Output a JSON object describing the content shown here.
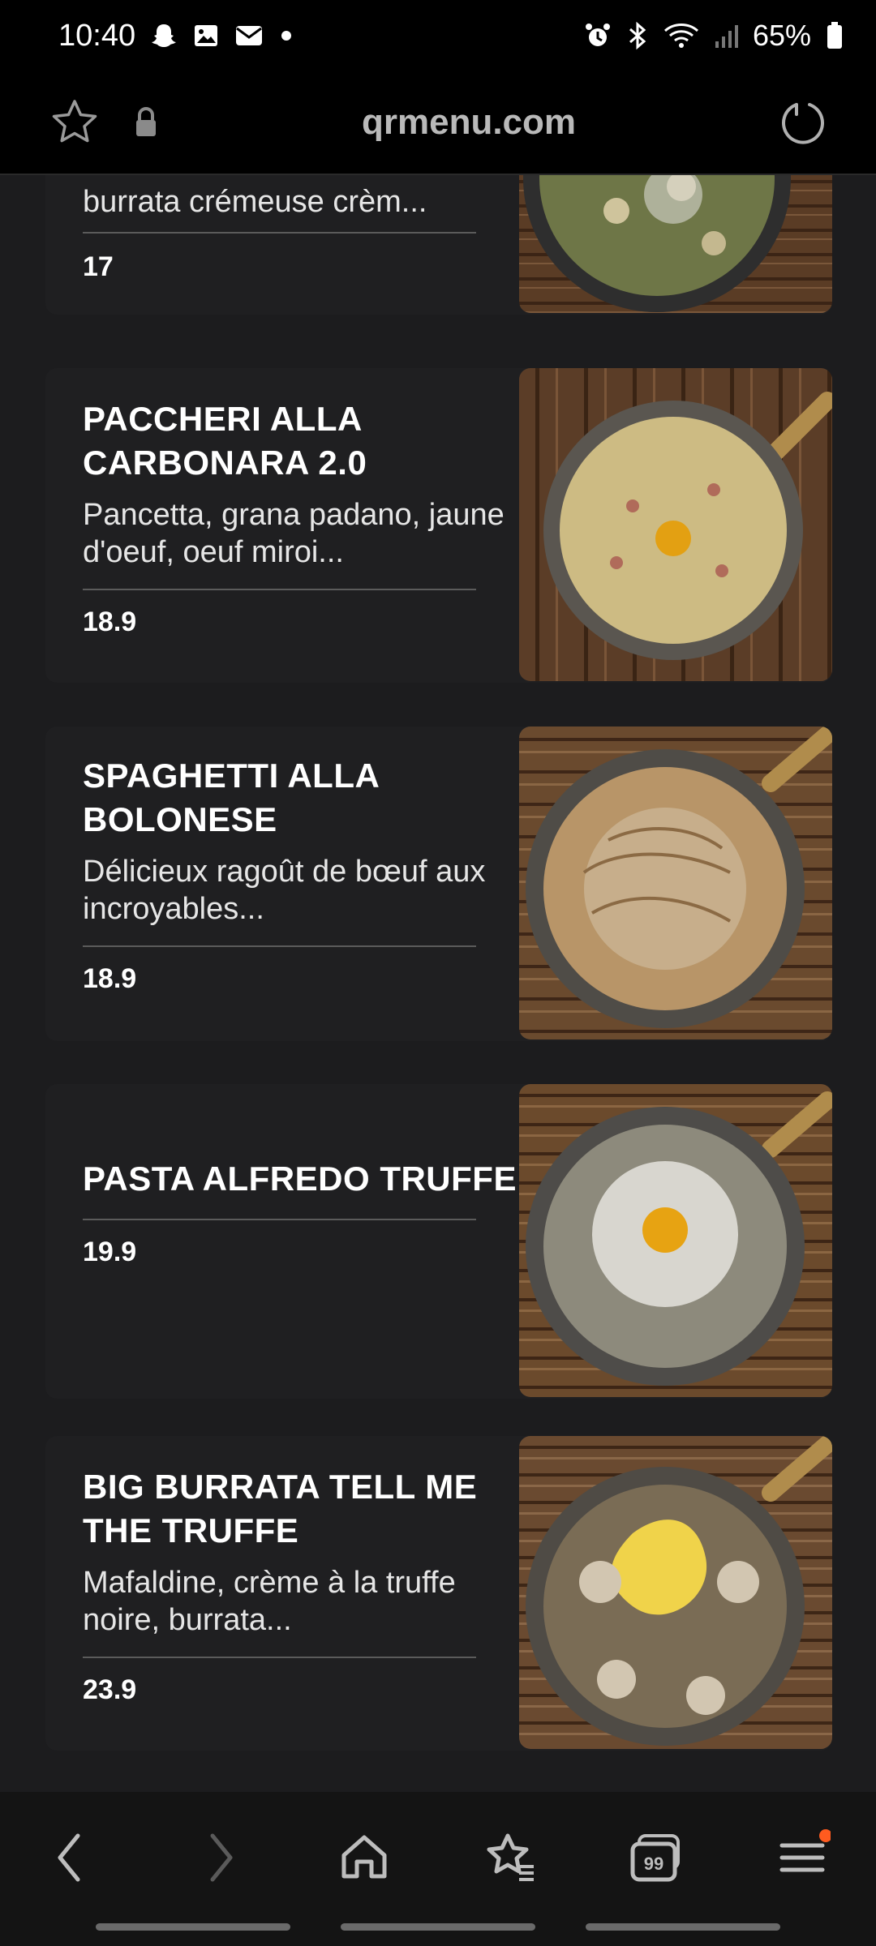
{
  "status_bar": {
    "time": "10:40",
    "battery": "65%",
    "icons": [
      "snapchat-icon",
      "gallery-icon",
      "mail-icon",
      "dot-icon",
      "alarm-icon",
      "bluetooth-icon",
      "wifi-icon",
      "signal-icon",
      "battery-icon"
    ]
  },
  "browser": {
    "url": "qrmenu.com",
    "icons": [
      "star-icon",
      "lock-icon",
      "reload-icon"
    ]
  },
  "menu": {
    "items": [
      {
        "name": "",
        "description": "burrata crémeuse crèm...",
        "price": "17"
      },
      {
        "name": "PACCHERI ALLA CARBONARA 2.0",
        "description": "Pancetta, grana padano, jaune d'oeuf, oeuf miroi...",
        "price": "18.9"
      },
      {
        "name": "SPAGHETTI ALLA BOLONESE",
        "description": "Délicieux ragoût de bœuf aux incroyables...",
        "price": "18.9"
      },
      {
        "name": "PASTA ALFREDO TRUFFE",
        "description": "",
        "price": "19.9"
      },
      {
        "name": "BIG BURRATA TELL ME THE TRUFFE",
        "description": "Mafaldine, crème à la truffe noire, burrata...",
        "price": "23.9"
      }
    ]
  },
  "bottom_nav": {
    "items": [
      "back-icon",
      "forward-icon",
      "home-icon",
      "bookmarks-icon",
      "tabs-icon",
      "menu-icon"
    ],
    "tabs_count": "99",
    "accent": "#ff5b1f"
  }
}
